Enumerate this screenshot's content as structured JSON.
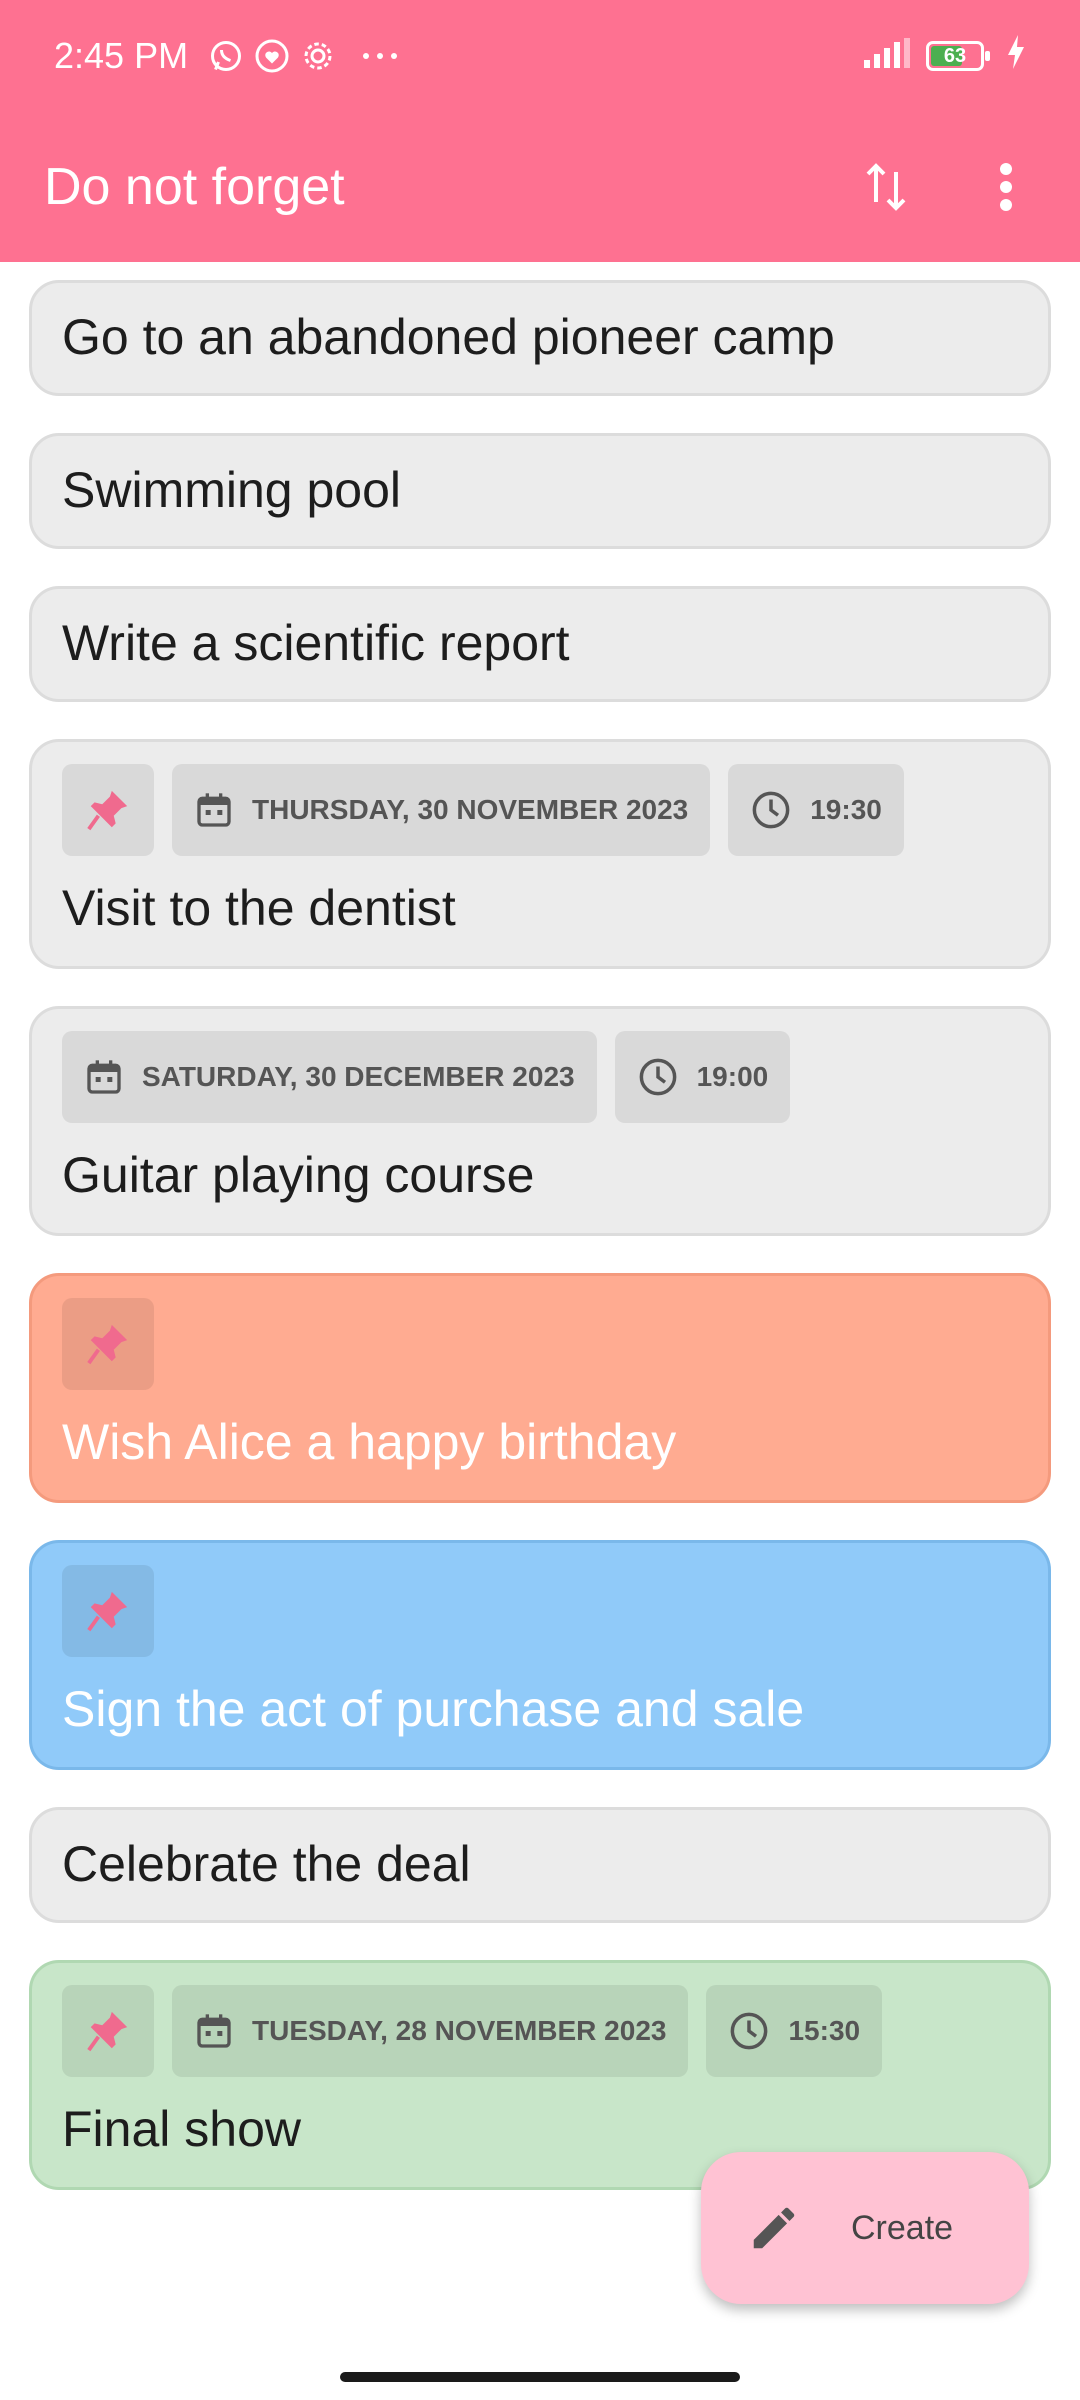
{
  "status_bar": {
    "time": "2:45 PM",
    "icons": [
      "whatsapp-icon",
      "messenger-icon",
      "settings-icon",
      "more-dots-icon"
    ],
    "battery_level": "63"
  },
  "app_bar": {
    "title": "Do not forget",
    "actions": [
      "sort-icon",
      "more-vert-icon"
    ]
  },
  "notes": [
    {
      "title": "Go to an abandoned pioneer camp"
    },
    {
      "title": "Swimming pool"
    },
    {
      "title": "Write a scientific report"
    },
    {
      "title": "Visit to the dentist",
      "pinned": true,
      "date": "THURSDAY, 30 NOVEMBER 2023",
      "time": "19:30"
    },
    {
      "title": "Guitar playing course",
      "date": "SATURDAY, 30 DECEMBER 2023",
      "time": "19:00"
    },
    {
      "title": "Wish Alice a happy birthday",
      "pinned": true,
      "color": "#ffab91"
    },
    {
      "title": "Sign the act of purchase and sale",
      "pinned": true,
      "color": "#90caf9"
    },
    {
      "title": "Celebrate the deal"
    },
    {
      "title": "Final show",
      "pinned": true,
      "date": "TUESDAY, 28 NOVEMBER 2023",
      "time": "15:30",
      "color": "#c8e6c9"
    }
  ],
  "fab": {
    "label": "Create",
    "icon": "pencil-icon"
  },
  "colors": {
    "primary": "#fe7191",
    "fab": "#ffc2d3",
    "pin": "#f06a8e"
  }
}
